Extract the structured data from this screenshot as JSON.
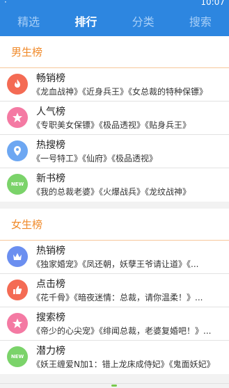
{
  "status": {
    "left": "·",
    "right": "10:07"
  },
  "tabs": [
    {
      "label": "精选"
    },
    {
      "label": "排行"
    },
    {
      "label": "分类"
    },
    {
      "label": "搜索"
    }
  ],
  "sections": [
    {
      "title": "男生榜",
      "items": [
        {
          "title": "畅销榜",
          "subtitle": "《龙血战神》《近身兵王》《女总裁的特种保镖》",
          "icon": "flame-icon",
          "color": "#f46b54"
        },
        {
          "title": "人气榜",
          "subtitle": "《专职美女保镖》《极品透视》《贴身兵王》",
          "icon": "star-icon",
          "color": "#f47aa3"
        },
        {
          "title": "热搜榜",
          "subtitle": "《一号特工》《仙府》《极品透视》",
          "icon": "location-icon",
          "color": "#6da7f2"
        },
        {
          "title": "新书榜",
          "subtitle": "《我的总裁老婆》《火爆战兵》《龙纹战神》",
          "icon": "new-icon",
          "color": "#7bd36a",
          "icon_text": "NEW"
        }
      ]
    },
    {
      "title": "女生榜",
      "items": [
        {
          "title": "热销榜",
          "subtitle": "《独家婚宠》《凤还朝，妖孽王爷请让道》《...",
          "icon": "crown-icon",
          "color": "#6b8ff0"
        },
        {
          "title": "点击榜",
          "subtitle": "《花千骨》《暗夜迷情：总裁，请你温柔！》...",
          "icon": "thumbs-up-icon",
          "color": "#f46b54"
        },
        {
          "title": "搜索榜",
          "subtitle": "《帝少的心尖宠》《绯闻总裁，老婆复婚吧！》...",
          "icon": "star-icon",
          "color": "#f47aa3"
        },
        {
          "title": "潜力榜",
          "subtitle": "《妖王缠爱N加1：错上龙床成侍妃》《鬼面妖妃》",
          "icon": "new-icon",
          "color": "#7bd36a",
          "icon_text": "NEW"
        }
      ]
    }
  ]
}
